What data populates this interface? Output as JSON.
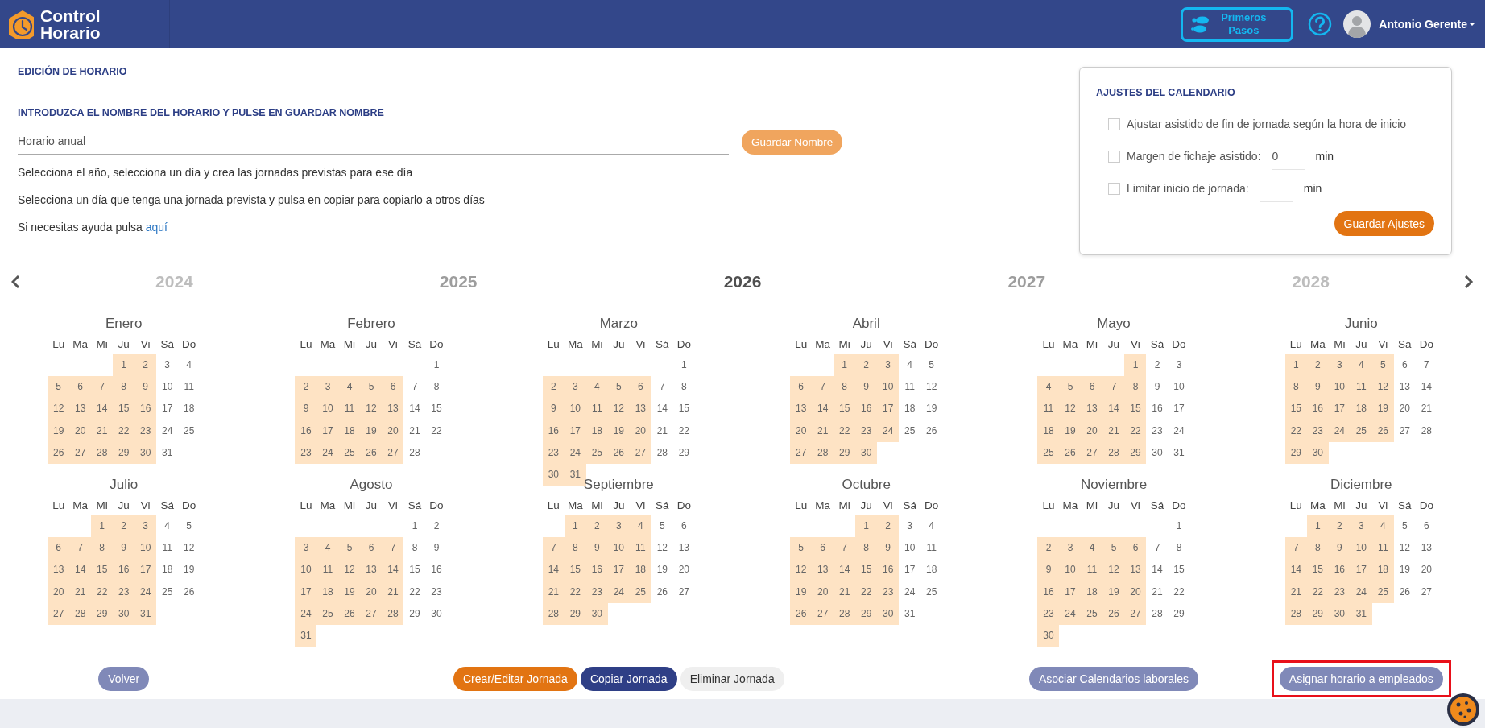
{
  "header": {
    "brand": "Control Horario",
    "guide_button": "Primeros Pasos",
    "user_name": "Antonio Gerente"
  },
  "editor": {
    "title": "EDICIÓN DE HORARIO",
    "instruction": "INTRODUZCA EL NOMBRE DEL HORARIO Y PULSE EN GUARDAR NOMBRE",
    "name_field": {
      "value": "Horario anual"
    },
    "save_name_button": "Guardar Nombre",
    "help_lines": [
      "Selecciona el año, selecciona un día y crea las jornadas previstas para ese día",
      "Selecciona un día que tenga una jornada prevista y pulsa en copiar para copiarlo a otros días"
    ],
    "help_link_line": {
      "text": "Si necesitas ayuda pulsa",
      "link": "aquí"
    }
  },
  "settings": {
    "title": "AJUSTES DEL CALENDARIO",
    "options": [
      {
        "kind": "checkbox",
        "label": "Ajustar asistido de fin de jornada según la hora de inicio",
        "checked": false
      },
      {
        "kind": "field",
        "label": "Margen de fichaje asistido:",
        "checked": false,
        "value": "0",
        "unit": "min"
      },
      {
        "kind": "field",
        "label": "Limitar inicio de jornada:",
        "checked": false,
        "unit": "min"
      }
    ],
    "save_button": "Guardar Ajustes"
  },
  "years": [
    {
      "label": "2024",
      "selected": false,
      "faded": true
    },
    {
      "label": "2025",
      "selected": false,
      "faded": false
    },
    {
      "label": "2026",
      "selected": true,
      "faded": false
    },
    {
      "label": "2027",
      "selected": false,
      "faded": false
    },
    {
      "label": "2028",
      "selected": false,
      "faded": true
    }
  ],
  "months": [
    {
      "name": "Enero",
      "weekday_labels": [
        "Lu",
        "Ma",
        "Mi",
        "Ju",
        "Vi",
        "Sá",
        "Do"
      ],
      "weeks": [
        [
          {
            "day": "1",
            "scheduled": true
          },
          {
            "day": "2",
            "scheduled": true
          },
          {
            "day": "3",
            "scheduled": false
          },
          {
            "day": "4",
            "scheduled": false
          }
        ],
        [
          {
            "day": "5",
            "scheduled": true
          },
          {
            "day": "6",
            "scheduled": true
          },
          {
            "day": "7",
            "scheduled": true
          },
          {
            "day": "8",
            "scheduled": true
          },
          {
            "day": "9",
            "scheduled": true
          },
          {
            "day": "10",
            "scheduled": false
          },
          {
            "day": "11",
            "scheduled": false
          }
        ],
        [
          {
            "day": "12",
            "scheduled": true
          },
          {
            "day": "13",
            "scheduled": true
          },
          {
            "day": "14",
            "scheduled": true
          },
          {
            "day": "15",
            "scheduled": true
          },
          {
            "day": "16",
            "scheduled": true
          },
          {
            "day": "17",
            "scheduled": false
          },
          {
            "day": "18",
            "scheduled": false
          }
        ],
        [
          {
            "day": "19",
            "scheduled": true
          },
          {
            "day": "20",
            "scheduled": true
          },
          {
            "day": "21",
            "scheduled": true
          },
          {
            "day": "22",
            "scheduled": true
          },
          {
            "day": "23",
            "scheduled": true
          },
          {
            "day": "24",
            "scheduled": false
          },
          {
            "day": "25",
            "scheduled": false
          }
        ],
        [
          {
            "day": "26",
            "scheduled": true
          },
          {
            "day": "27",
            "scheduled": true
          },
          {
            "day": "28",
            "scheduled": true
          },
          {
            "day": "29",
            "scheduled": true
          },
          {
            "day": "30",
            "scheduled": true
          },
          {
            "day": "31",
            "scheduled": false
          }
        ]
      ]
    },
    {
      "name": "Febrero",
      "weekday_labels": [
        "Lu",
        "Ma",
        "Mi",
        "Ju",
        "Vi",
        "Sá",
        "Do"
      ],
      "weeks": [
        [
          {
            "day": "1",
            "scheduled": false
          }
        ],
        [
          {
            "day": "2",
            "scheduled": true
          },
          {
            "day": "3",
            "scheduled": true
          },
          {
            "day": "4",
            "scheduled": true
          },
          {
            "day": "5",
            "scheduled": true
          },
          {
            "day": "6",
            "scheduled": true
          },
          {
            "day": "7",
            "scheduled": false
          },
          {
            "day": "8",
            "scheduled": false
          }
        ],
        [
          {
            "day": "9",
            "scheduled": true
          },
          {
            "day": "10",
            "scheduled": true
          },
          {
            "day": "11",
            "scheduled": true
          },
          {
            "day": "12",
            "scheduled": true
          },
          {
            "day": "13",
            "scheduled": true
          },
          {
            "day": "14",
            "scheduled": false
          },
          {
            "day": "15",
            "scheduled": false
          }
        ],
        [
          {
            "day": "16",
            "scheduled": true
          },
          {
            "day": "17",
            "scheduled": true
          },
          {
            "day": "18",
            "scheduled": true
          },
          {
            "day": "19",
            "scheduled": true
          },
          {
            "day": "20",
            "scheduled": true
          },
          {
            "day": "21",
            "scheduled": false
          },
          {
            "day": "22",
            "scheduled": false
          }
        ],
        [
          {
            "day": "23",
            "scheduled": true
          },
          {
            "day": "24",
            "scheduled": true
          },
          {
            "day": "25",
            "scheduled": true
          },
          {
            "day": "26",
            "scheduled": true
          },
          {
            "day": "27",
            "scheduled": true
          },
          {
            "day": "28",
            "scheduled": false
          }
        ]
      ]
    },
    {
      "name": "Marzo",
      "weekday_labels": [
        "Lu",
        "Ma",
        "Mi",
        "Ju",
        "Vi",
        "Sá",
        "Do"
      ],
      "weeks": [
        [
          {
            "day": "1",
            "scheduled": false
          }
        ],
        [
          {
            "day": "2",
            "scheduled": true
          },
          {
            "day": "3",
            "scheduled": true
          },
          {
            "day": "4",
            "scheduled": true
          },
          {
            "day": "5",
            "scheduled": true
          },
          {
            "day": "6",
            "scheduled": true
          },
          {
            "day": "7",
            "scheduled": false
          },
          {
            "day": "8",
            "scheduled": false
          }
        ],
        [
          {
            "day": "9",
            "scheduled": true
          },
          {
            "day": "10",
            "scheduled": true
          },
          {
            "day": "11",
            "scheduled": true
          },
          {
            "day": "12",
            "scheduled": true
          },
          {
            "day": "13",
            "scheduled": true
          },
          {
            "day": "14",
            "scheduled": false
          },
          {
            "day": "15",
            "scheduled": false
          }
        ],
        [
          {
            "day": "16",
            "scheduled": true
          },
          {
            "day": "17",
            "scheduled": true
          },
          {
            "day": "18",
            "scheduled": true
          },
          {
            "day": "19",
            "scheduled": true
          },
          {
            "day": "20",
            "scheduled": true
          },
          {
            "day": "21",
            "scheduled": false
          },
          {
            "day": "22",
            "scheduled": false
          }
        ],
        [
          {
            "day": "23",
            "scheduled": true
          },
          {
            "day": "24",
            "scheduled": true
          },
          {
            "day": "25",
            "scheduled": true
          },
          {
            "day": "26",
            "scheduled": true
          },
          {
            "day": "27",
            "scheduled": true
          },
          {
            "day": "28",
            "scheduled": false
          },
          {
            "day": "29",
            "scheduled": false
          }
        ],
        [
          {
            "day": "30",
            "scheduled": true
          },
          {
            "day": "31",
            "scheduled": true
          }
        ]
      ]
    },
    {
      "name": "Abril",
      "weekday_labels": [
        "Lu",
        "Ma",
        "Mi",
        "Ju",
        "Vi",
        "Sá",
        "Do"
      ],
      "weeks": [
        [
          {
            "day": "1",
            "scheduled": true
          },
          {
            "day": "2",
            "scheduled": true
          },
          {
            "day": "3",
            "scheduled": true
          },
          {
            "day": "4",
            "scheduled": false
          },
          {
            "day": "5",
            "scheduled": false
          }
        ],
        [
          {
            "day": "6",
            "scheduled": true
          },
          {
            "day": "7",
            "scheduled": true
          },
          {
            "day": "8",
            "scheduled": true
          },
          {
            "day": "9",
            "scheduled": true
          },
          {
            "day": "10",
            "scheduled": true
          },
          {
            "day": "11",
            "scheduled": false
          },
          {
            "day": "12",
            "scheduled": false
          }
        ],
        [
          {
            "day": "13",
            "scheduled": true
          },
          {
            "day": "14",
            "scheduled": true
          },
          {
            "day": "15",
            "scheduled": true
          },
          {
            "day": "16",
            "scheduled": true
          },
          {
            "day": "17",
            "scheduled": true
          },
          {
            "day": "18",
            "scheduled": false
          },
          {
            "day": "19",
            "scheduled": false
          }
        ],
        [
          {
            "day": "20",
            "scheduled": true
          },
          {
            "day": "21",
            "scheduled": true
          },
          {
            "day": "22",
            "scheduled": true
          },
          {
            "day": "23",
            "scheduled": true
          },
          {
            "day": "24",
            "scheduled": true
          },
          {
            "day": "25",
            "scheduled": false
          },
          {
            "day": "26",
            "scheduled": false
          }
        ],
        [
          {
            "day": "27",
            "scheduled": true
          },
          {
            "day": "28",
            "scheduled": true
          },
          {
            "day": "29",
            "scheduled": true
          },
          {
            "day": "30",
            "scheduled": true
          }
        ]
      ]
    },
    {
      "name": "Mayo",
      "weekday_labels": [
        "Lu",
        "Ma",
        "Mi",
        "Ju",
        "Vi",
        "Sá",
        "Do"
      ],
      "weeks": [
        [
          {
            "day": "1",
            "scheduled": true
          },
          {
            "day": "2",
            "scheduled": false
          },
          {
            "day": "3",
            "scheduled": false
          }
        ],
        [
          {
            "day": "4",
            "scheduled": true
          },
          {
            "day": "5",
            "scheduled": true
          },
          {
            "day": "6",
            "scheduled": true
          },
          {
            "day": "7",
            "scheduled": true
          },
          {
            "day": "8",
            "scheduled": true
          },
          {
            "day": "9",
            "scheduled": false
          },
          {
            "day": "10",
            "scheduled": false
          }
        ],
        [
          {
            "day": "11",
            "scheduled": true
          },
          {
            "day": "12",
            "scheduled": true
          },
          {
            "day": "13",
            "scheduled": true
          },
          {
            "day": "14",
            "scheduled": true
          },
          {
            "day": "15",
            "scheduled": true
          },
          {
            "day": "16",
            "scheduled": false
          },
          {
            "day": "17",
            "scheduled": false
          }
        ],
        [
          {
            "day": "18",
            "scheduled": true
          },
          {
            "day": "19",
            "scheduled": true
          },
          {
            "day": "20",
            "scheduled": true
          },
          {
            "day": "21",
            "scheduled": true
          },
          {
            "day": "22",
            "scheduled": true
          },
          {
            "day": "23",
            "scheduled": false
          },
          {
            "day": "24",
            "scheduled": false
          }
        ],
        [
          {
            "day": "25",
            "scheduled": true
          },
          {
            "day": "26",
            "scheduled": true
          },
          {
            "day": "27",
            "scheduled": true
          },
          {
            "day": "28",
            "scheduled": true
          },
          {
            "day": "29",
            "scheduled": true
          },
          {
            "day": "30",
            "scheduled": false
          },
          {
            "day": "31",
            "scheduled": false
          }
        ]
      ]
    },
    {
      "name": "Junio",
      "weekday_labels": [
        "Lu",
        "Ma",
        "Mi",
        "Ju",
        "Vi",
        "Sá",
        "Do"
      ],
      "weeks": [
        [
          {
            "day": "1",
            "scheduled": true
          },
          {
            "day": "2",
            "scheduled": true
          },
          {
            "day": "3",
            "scheduled": true
          },
          {
            "day": "4",
            "scheduled": true
          },
          {
            "day": "5",
            "scheduled": true
          },
          {
            "day": "6",
            "scheduled": false
          },
          {
            "day": "7",
            "scheduled": false
          }
        ],
        [
          {
            "day": "8",
            "scheduled": true
          },
          {
            "day": "9",
            "scheduled": true
          },
          {
            "day": "10",
            "scheduled": true
          },
          {
            "day": "11",
            "scheduled": true
          },
          {
            "day": "12",
            "scheduled": true
          },
          {
            "day": "13",
            "scheduled": false
          },
          {
            "day": "14",
            "scheduled": false
          }
        ],
        [
          {
            "day": "15",
            "scheduled": true
          },
          {
            "day": "16",
            "scheduled": true
          },
          {
            "day": "17",
            "scheduled": true
          },
          {
            "day": "18",
            "scheduled": true
          },
          {
            "day": "19",
            "scheduled": true
          },
          {
            "day": "20",
            "scheduled": false
          },
          {
            "day": "21",
            "scheduled": false
          }
        ],
        [
          {
            "day": "22",
            "scheduled": true
          },
          {
            "day": "23",
            "scheduled": true
          },
          {
            "day": "24",
            "scheduled": true
          },
          {
            "day": "25",
            "scheduled": true
          },
          {
            "day": "26",
            "scheduled": true
          },
          {
            "day": "27",
            "scheduled": false
          },
          {
            "day": "28",
            "scheduled": false
          }
        ],
        [
          {
            "day": "29",
            "scheduled": true
          },
          {
            "day": "30",
            "scheduled": true
          }
        ]
      ]
    },
    {
      "name": "Julio",
      "weekday_labels": [
        "Lu",
        "Ma",
        "Mi",
        "Ju",
        "Vi",
        "Sá",
        "Do"
      ],
      "weeks": [
        [
          {
            "day": "1",
            "scheduled": true
          },
          {
            "day": "2",
            "scheduled": true
          },
          {
            "day": "3",
            "scheduled": true
          },
          {
            "day": "4",
            "scheduled": false
          },
          {
            "day": "5",
            "scheduled": false
          }
        ],
        [
          {
            "day": "6",
            "scheduled": true
          },
          {
            "day": "7",
            "scheduled": true
          },
          {
            "day": "8",
            "scheduled": true
          },
          {
            "day": "9",
            "scheduled": true
          },
          {
            "day": "10",
            "scheduled": true
          },
          {
            "day": "11",
            "scheduled": false
          },
          {
            "day": "12",
            "scheduled": false
          }
        ],
        [
          {
            "day": "13",
            "scheduled": true
          },
          {
            "day": "14",
            "scheduled": true
          },
          {
            "day": "15",
            "scheduled": true
          },
          {
            "day": "16",
            "scheduled": true
          },
          {
            "day": "17",
            "scheduled": true
          },
          {
            "day": "18",
            "scheduled": false
          },
          {
            "day": "19",
            "scheduled": false
          }
        ],
        [
          {
            "day": "20",
            "scheduled": true
          },
          {
            "day": "21",
            "scheduled": true
          },
          {
            "day": "22",
            "scheduled": true
          },
          {
            "day": "23",
            "scheduled": true
          },
          {
            "day": "24",
            "scheduled": true
          },
          {
            "day": "25",
            "scheduled": false
          },
          {
            "day": "26",
            "scheduled": false
          }
        ],
        [
          {
            "day": "27",
            "scheduled": true
          },
          {
            "day": "28",
            "scheduled": true
          },
          {
            "day": "29",
            "scheduled": true
          },
          {
            "day": "30",
            "scheduled": true
          },
          {
            "day": "31",
            "scheduled": true
          }
        ]
      ]
    },
    {
      "name": "Agosto",
      "weekday_labels": [
        "Lu",
        "Ma",
        "Mi",
        "Ju",
        "Vi",
        "Sá",
        "Do"
      ],
      "weeks": [
        [
          {
            "day": "1",
            "scheduled": false
          },
          {
            "day": "2",
            "scheduled": false
          }
        ],
        [
          {
            "day": "3",
            "scheduled": true
          },
          {
            "day": "4",
            "scheduled": true
          },
          {
            "day": "5",
            "scheduled": true
          },
          {
            "day": "6",
            "scheduled": true
          },
          {
            "day": "7",
            "scheduled": true
          },
          {
            "day": "8",
            "scheduled": false
          },
          {
            "day": "9",
            "scheduled": false
          }
        ],
        [
          {
            "day": "10",
            "scheduled": true
          },
          {
            "day": "11",
            "scheduled": true
          },
          {
            "day": "12",
            "scheduled": true
          },
          {
            "day": "13",
            "scheduled": true
          },
          {
            "day": "14",
            "scheduled": true
          },
          {
            "day": "15",
            "scheduled": false
          },
          {
            "day": "16",
            "scheduled": false
          }
        ],
        [
          {
            "day": "17",
            "scheduled": true
          },
          {
            "day": "18",
            "scheduled": true
          },
          {
            "day": "19",
            "scheduled": true
          },
          {
            "day": "20",
            "scheduled": true
          },
          {
            "day": "21",
            "scheduled": true
          },
          {
            "day": "22",
            "scheduled": false
          },
          {
            "day": "23",
            "scheduled": false
          }
        ],
        [
          {
            "day": "24",
            "scheduled": true
          },
          {
            "day": "25",
            "scheduled": true
          },
          {
            "day": "26",
            "scheduled": true
          },
          {
            "day": "27",
            "scheduled": true
          },
          {
            "day": "28",
            "scheduled": true
          },
          {
            "day": "29",
            "scheduled": false
          },
          {
            "day": "30",
            "scheduled": false
          }
        ],
        [
          {
            "day": "31",
            "scheduled": true
          }
        ]
      ]
    },
    {
      "name": "Septiembre",
      "weekday_labels": [
        "Lu",
        "Ma",
        "Mi",
        "Ju",
        "Vi",
        "Sá",
        "Do"
      ],
      "weeks": [
        [
          {
            "day": "1",
            "scheduled": true
          },
          {
            "day": "2",
            "scheduled": true
          },
          {
            "day": "3",
            "scheduled": true
          },
          {
            "day": "4",
            "scheduled": true
          },
          {
            "day": "5",
            "scheduled": false
          },
          {
            "day": "6",
            "scheduled": false
          }
        ],
        [
          {
            "day": "7",
            "scheduled": true
          },
          {
            "day": "8",
            "scheduled": true
          },
          {
            "day": "9",
            "scheduled": true
          },
          {
            "day": "10",
            "scheduled": true
          },
          {
            "day": "11",
            "scheduled": true
          },
          {
            "day": "12",
            "scheduled": false
          },
          {
            "day": "13",
            "scheduled": false
          }
        ],
        [
          {
            "day": "14",
            "scheduled": true
          },
          {
            "day": "15",
            "scheduled": true
          },
          {
            "day": "16",
            "scheduled": true
          },
          {
            "day": "17",
            "scheduled": true
          },
          {
            "day": "18",
            "scheduled": true
          },
          {
            "day": "19",
            "scheduled": false
          },
          {
            "day": "20",
            "scheduled": false
          }
        ],
        [
          {
            "day": "21",
            "scheduled": true
          },
          {
            "day": "22",
            "scheduled": true
          },
          {
            "day": "23",
            "scheduled": true
          },
          {
            "day": "24",
            "scheduled": true
          },
          {
            "day": "25",
            "scheduled": true
          },
          {
            "day": "26",
            "scheduled": false
          },
          {
            "day": "27",
            "scheduled": false
          }
        ],
        [
          {
            "day": "28",
            "scheduled": true
          },
          {
            "day": "29",
            "scheduled": true
          },
          {
            "day": "30",
            "scheduled": true
          }
        ]
      ]
    },
    {
      "name": "Octubre",
      "weekday_labels": [
        "Lu",
        "Ma",
        "Mi",
        "Ju",
        "Vi",
        "Sá",
        "Do"
      ],
      "weeks": [
        [
          {
            "day": "1",
            "scheduled": true
          },
          {
            "day": "2",
            "scheduled": true
          },
          {
            "day": "3",
            "scheduled": false
          },
          {
            "day": "4",
            "scheduled": false
          }
        ],
        [
          {
            "day": "5",
            "scheduled": true
          },
          {
            "day": "6",
            "scheduled": true
          },
          {
            "day": "7",
            "scheduled": true
          },
          {
            "day": "8",
            "scheduled": true
          },
          {
            "day": "9",
            "scheduled": true
          },
          {
            "day": "10",
            "scheduled": false
          },
          {
            "day": "11",
            "scheduled": false
          }
        ],
        [
          {
            "day": "12",
            "scheduled": true
          },
          {
            "day": "13",
            "scheduled": true
          },
          {
            "day": "14",
            "scheduled": true
          },
          {
            "day": "15",
            "scheduled": true
          },
          {
            "day": "16",
            "scheduled": true
          },
          {
            "day": "17",
            "scheduled": false
          },
          {
            "day": "18",
            "scheduled": false
          }
        ],
        [
          {
            "day": "19",
            "scheduled": true
          },
          {
            "day": "20",
            "scheduled": true
          },
          {
            "day": "21",
            "scheduled": true
          },
          {
            "day": "22",
            "scheduled": true
          },
          {
            "day": "23",
            "scheduled": true
          },
          {
            "day": "24",
            "scheduled": false
          },
          {
            "day": "25",
            "scheduled": false
          }
        ],
        [
          {
            "day": "26",
            "scheduled": true
          },
          {
            "day": "27",
            "scheduled": true
          },
          {
            "day": "28",
            "scheduled": true
          },
          {
            "day": "29",
            "scheduled": true
          },
          {
            "day": "30",
            "scheduled": true
          },
          {
            "day": "31",
            "scheduled": false
          }
        ]
      ]
    },
    {
      "name": "Noviembre",
      "weekday_labels": [
        "Lu",
        "Ma",
        "Mi",
        "Ju",
        "Vi",
        "Sá",
        "Do"
      ],
      "weeks": [
        [
          {
            "day": "1",
            "scheduled": false
          }
        ],
        [
          {
            "day": "2",
            "scheduled": true
          },
          {
            "day": "3",
            "scheduled": true
          },
          {
            "day": "4",
            "scheduled": true
          },
          {
            "day": "5",
            "scheduled": true
          },
          {
            "day": "6",
            "scheduled": true
          },
          {
            "day": "7",
            "scheduled": false
          },
          {
            "day": "8",
            "scheduled": false
          }
        ],
        [
          {
            "day": "9",
            "scheduled": true
          },
          {
            "day": "10",
            "scheduled": true
          },
          {
            "day": "11",
            "scheduled": true
          },
          {
            "day": "12",
            "scheduled": true
          },
          {
            "day": "13",
            "scheduled": true
          },
          {
            "day": "14",
            "scheduled": false
          },
          {
            "day": "15",
            "scheduled": false
          }
        ],
        [
          {
            "day": "16",
            "scheduled": true
          },
          {
            "day": "17",
            "scheduled": true
          },
          {
            "day": "18",
            "scheduled": true
          },
          {
            "day": "19",
            "scheduled": true
          },
          {
            "day": "20",
            "scheduled": true
          },
          {
            "day": "21",
            "scheduled": false
          },
          {
            "day": "22",
            "scheduled": false
          }
        ],
        [
          {
            "day": "23",
            "scheduled": true
          },
          {
            "day": "24",
            "scheduled": true
          },
          {
            "day": "25",
            "scheduled": true
          },
          {
            "day": "26",
            "scheduled": true
          },
          {
            "day": "27",
            "scheduled": true
          },
          {
            "day": "28",
            "scheduled": false
          },
          {
            "day": "29",
            "scheduled": false
          }
        ],
        [
          {
            "day": "30",
            "scheduled": true
          }
        ]
      ]
    },
    {
      "name": "Diciembre",
      "weekday_labels": [
        "Lu",
        "Ma",
        "Mi",
        "Ju",
        "Vi",
        "Sá",
        "Do"
      ],
      "weeks": [
        [
          {
            "day": "1",
            "scheduled": true
          },
          {
            "day": "2",
            "scheduled": true
          },
          {
            "day": "3",
            "scheduled": true
          },
          {
            "day": "4",
            "scheduled": true
          },
          {
            "day": "5",
            "scheduled": false
          },
          {
            "day": "6",
            "scheduled": false
          }
        ],
        [
          {
            "day": "7",
            "scheduled": true
          },
          {
            "day": "8",
            "scheduled": true
          },
          {
            "day": "9",
            "scheduled": true
          },
          {
            "day": "10",
            "scheduled": true
          },
          {
            "day": "11",
            "scheduled": true
          },
          {
            "day": "12",
            "scheduled": false
          },
          {
            "day": "13",
            "scheduled": false
          }
        ],
        [
          {
            "day": "14",
            "scheduled": true
          },
          {
            "day": "15",
            "scheduled": true
          },
          {
            "day": "16",
            "scheduled": true
          },
          {
            "day": "17",
            "scheduled": true
          },
          {
            "day": "18",
            "scheduled": true
          },
          {
            "day": "19",
            "scheduled": false
          },
          {
            "day": "20",
            "scheduled": false
          }
        ],
        [
          {
            "day": "21",
            "scheduled": true
          },
          {
            "day": "22",
            "scheduled": true
          },
          {
            "day": "23",
            "scheduled": true
          },
          {
            "day": "24",
            "scheduled": true
          },
          {
            "day": "25",
            "scheduled": true
          },
          {
            "day": "26",
            "scheduled": false
          },
          {
            "day": "27",
            "scheduled": false
          }
        ],
        [
          {
            "day": "28",
            "scheduled": true
          },
          {
            "day": "29",
            "scheduled": true
          },
          {
            "day": "30",
            "scheduled": true
          },
          {
            "day": "31",
            "scheduled": true
          }
        ]
      ]
    }
  ],
  "action_groups": [
    {
      "buttons": [
        {
          "label": "Volver",
          "kind": "muted",
          "highlighted": false
        }
      ]
    },
    {
      "buttons": [
        {
          "label": "Crear/Editar Jornada",
          "kind": "accent",
          "highlighted": false
        },
        {
          "label": "Copiar Jornada",
          "kind": "primary",
          "highlighted": false
        },
        {
          "label": "Eliminar Jornada",
          "kind": "light",
          "highlighted": false
        }
      ]
    },
    {
      "buttons": [
        {
          "label": "Asociar Calendarios laborales",
          "kind": "muted",
          "highlighted": false
        }
      ]
    },
    {
      "buttons": [
        {
          "label": "Asignar horario a empleados",
          "kind": "muted",
          "highlighted": true
        }
      ]
    }
  ]
}
